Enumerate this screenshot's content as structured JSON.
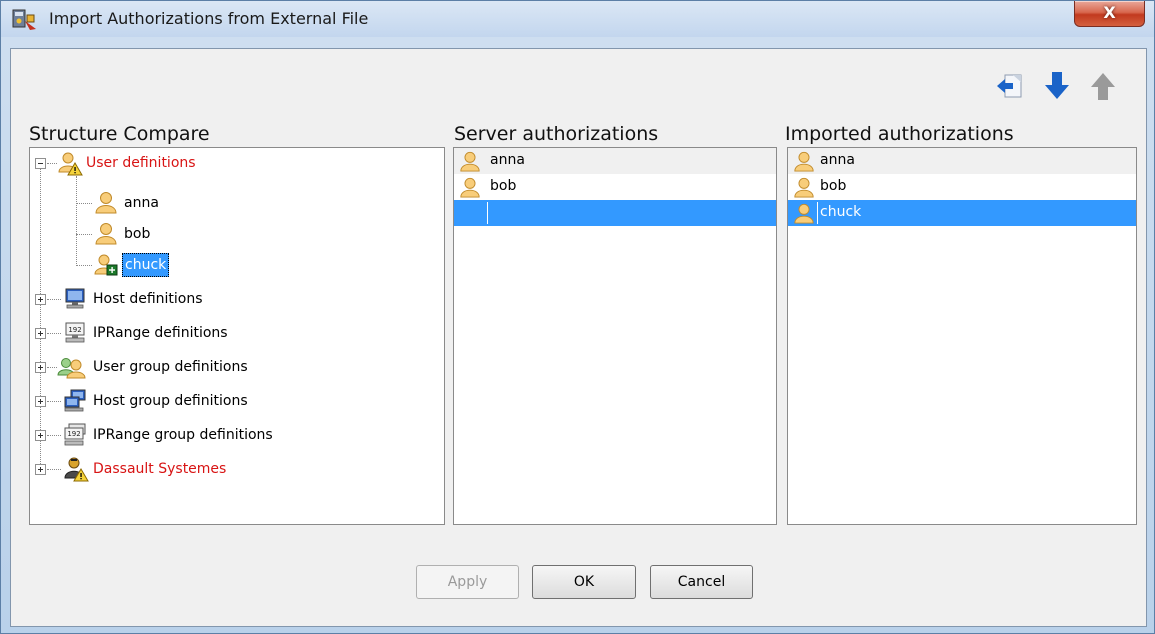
{
  "window": {
    "title": "Import Authorizations from External File",
    "close_label": "X"
  },
  "toolbar": {
    "icons": [
      "import-left-icon",
      "arrow-down-icon",
      "arrow-up-icon"
    ]
  },
  "structure": {
    "heading": "Structure Compare",
    "items": [
      {
        "label": "User definitions",
        "icon": "user-warning-icon",
        "color": "#d81414",
        "expanded": true,
        "children": [
          {
            "label": "anna",
            "icon": "user-icon"
          },
          {
            "label": "bob",
            "icon": "user-icon"
          },
          {
            "label": "chuck",
            "icon": "user-add-icon",
            "selected": true
          }
        ]
      },
      {
        "label": "Host definitions",
        "icon": "host-icon"
      },
      {
        "label": "IPRange definitions",
        "icon": "iprange-icon"
      },
      {
        "label": "User group definitions",
        "icon": "user-group-icon"
      },
      {
        "label": "Host group definitions",
        "icon": "host-group-icon"
      },
      {
        "label": "IPRange group definitions",
        "icon": "iprange-group-icon"
      },
      {
        "label": "Dassault Systemes",
        "icon": "org-warning-icon",
        "color": "#d81414"
      }
    ]
  },
  "server": {
    "heading": "Server authorizations",
    "rows": [
      {
        "label": "anna",
        "icon": "user-icon"
      },
      {
        "label": "bob",
        "icon": "user-icon"
      },
      {
        "label": "",
        "selected": true
      }
    ]
  },
  "imported": {
    "heading": "Imported authorizations",
    "rows": [
      {
        "label": "anna",
        "icon": "user-icon"
      },
      {
        "label": "bob",
        "icon": "user-icon"
      },
      {
        "label": "chuck",
        "icon": "user-icon",
        "selected": true
      }
    ]
  },
  "buttons": {
    "apply": "Apply",
    "ok": "OK",
    "cancel": "Cancel"
  },
  "colors": {
    "selection": "#3399ff",
    "warning_text": "#d81414",
    "toolbar_blue": "#1a63c8"
  }
}
